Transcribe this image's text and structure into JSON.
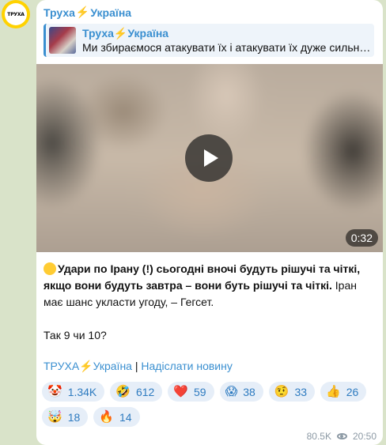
{
  "channel": {
    "name_part1": "Труха",
    "bolt": "⚡",
    "name_part2": "Україна",
    "avatar_text": "ТРУХА"
  },
  "forward": {
    "title_part1": "Труха",
    "bolt": "⚡",
    "title_part2": "Україна",
    "body": "Ми збираємося атакувати їх і атакувати їх дуже сильн…"
  },
  "video": {
    "duration": "0:32"
  },
  "message": {
    "bold_text": "Удари по Ірану (!) сьогодні вночі будуть рішучі та чіткі, якщо вони будуть завтра – вони буть рішучі та чіткі.",
    "normal_text": " Іран має шанс укласти угоду, – Гегсет.",
    "question": "Так 9 чи 10?"
  },
  "links": {
    "channel_part1": "ТРУХА",
    "bolt": "⚡",
    "channel_part2": "Україна",
    "separator": " | ",
    "submit": "Надіслати новину"
  },
  "reactions": [
    {
      "icon": "🤡",
      "count": "1.34K"
    },
    {
      "icon": "🤣",
      "count": "612"
    },
    {
      "icon": "❤️",
      "count": "59"
    },
    {
      "icon": "😱",
      "count": "38"
    },
    {
      "icon": "🤨",
      "count": "33"
    },
    {
      "icon": "👍",
      "count": "26"
    },
    {
      "icon": "🤯",
      "count": "18"
    },
    {
      "icon": "🔥",
      "count": "14"
    }
  ],
  "meta": {
    "views": "80.5K",
    "time": "20:50"
  }
}
